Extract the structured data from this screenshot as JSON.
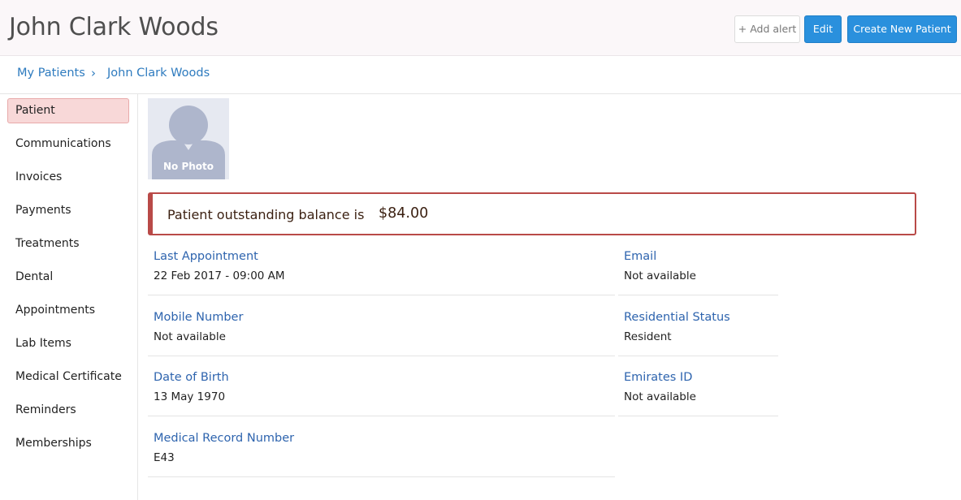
{
  "header": {
    "title": "John Clark Woods",
    "add_alert_label": "+ Add alert",
    "edit_label": "Edit",
    "create_label": "Create New Patient"
  },
  "breadcrumb": {
    "root": "My Patients",
    "separator": "›",
    "current": "John Clark Woods"
  },
  "sidebar": {
    "items": [
      {
        "label": "Patient",
        "active": true
      },
      {
        "label": "Communications"
      },
      {
        "label": "Invoices"
      },
      {
        "label": "Payments"
      },
      {
        "label": "Treatments"
      },
      {
        "label": "Dental"
      },
      {
        "label": "Appointments"
      },
      {
        "label": "Lab Items"
      },
      {
        "label": "Medical Certificate"
      },
      {
        "label": "Reminders"
      },
      {
        "label": "Memberships"
      }
    ]
  },
  "photo": {
    "label": "No Photo",
    "icon": "avatar-placeholder-icon"
  },
  "balance": {
    "label": "Patient outstanding balance is",
    "amount": "$84.00"
  },
  "fields": {
    "last_appointment": {
      "label": "Last Appointment",
      "value": "22 Feb 2017 - 09:00 AM"
    },
    "email": {
      "label": "Email",
      "value": "Not available"
    },
    "mobile": {
      "label": "Mobile Number",
      "value": "Not available"
    },
    "residential_status": {
      "label": "Residential Status",
      "value": "Resident"
    },
    "dob": {
      "label": "Date of Birth",
      "value": "13 May 1970"
    },
    "emirates_id": {
      "label": "Emirates ID",
      "value": "Not available"
    },
    "mrn": {
      "label": "Medical Record Number",
      "value": "E43"
    }
  },
  "colors": {
    "accent": "#2a90dd",
    "link": "#2e7bbf",
    "field_label": "#2e64ae",
    "alert_border": "#b94a48",
    "active_nav_bg": "#f8d8d8"
  }
}
